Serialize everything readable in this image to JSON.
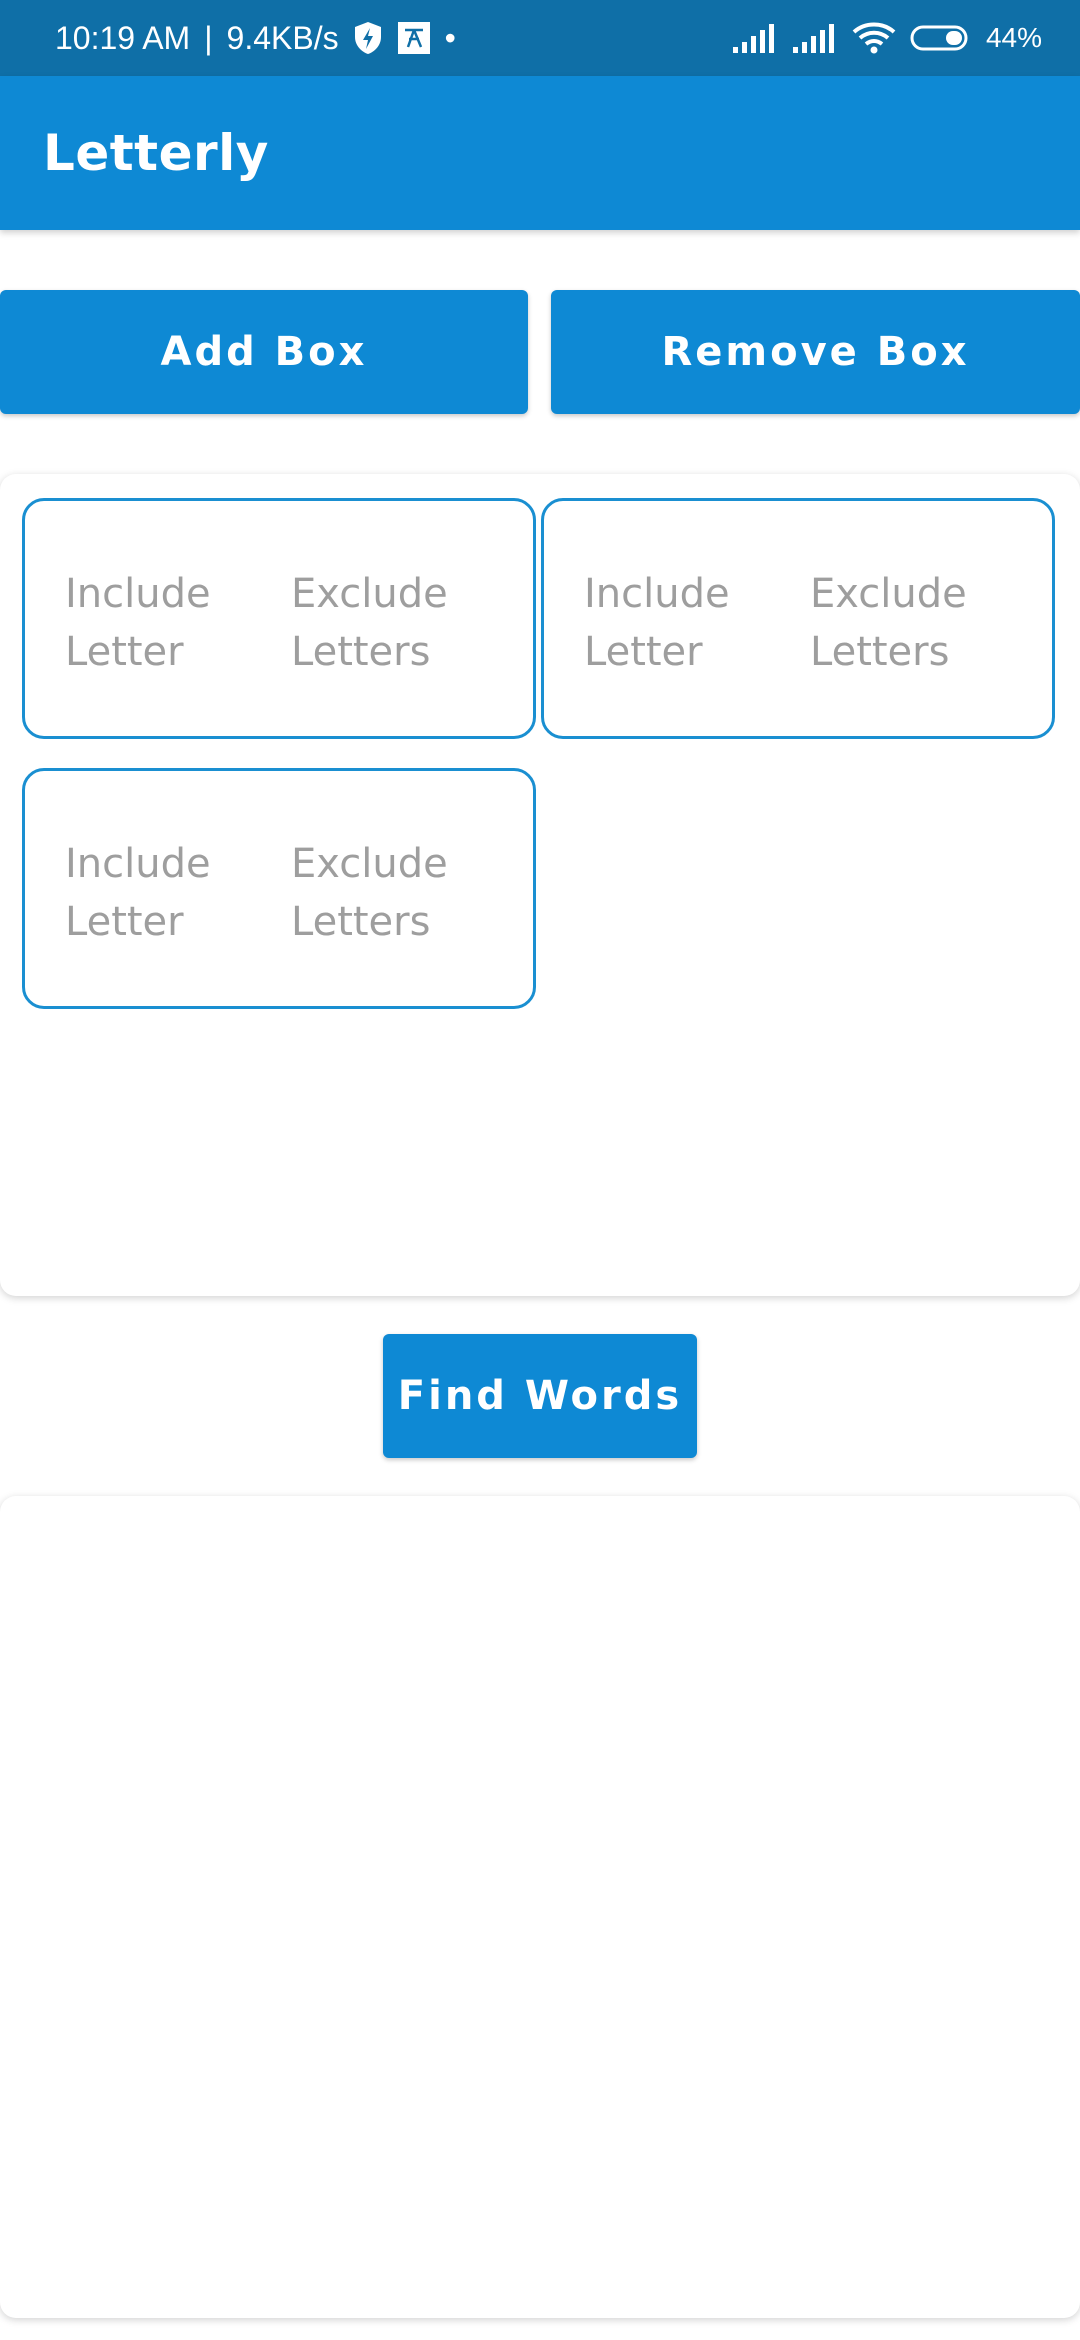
{
  "status_bar": {
    "time": "10:19 AM",
    "separator": "|",
    "speed": "9.4KB/s",
    "dot": "•",
    "battery": "44%",
    "icons": [
      "shield-bolt-icon",
      "app-notification-icon",
      "signal-icon",
      "signal-icon",
      "wifi-icon",
      "battery-icon"
    ]
  },
  "app_bar": {
    "title": "Letterly"
  },
  "actions": {
    "add_label": "Add Box",
    "remove_label": "Remove Box",
    "find_label": "Find Words"
  },
  "boxes": [
    {
      "include_placeholder": "Include\nLetter",
      "exclude_placeholder": "Exclude\nLetters"
    },
    {
      "include_placeholder": "Include\nLetter",
      "exclude_placeholder": "Exclude\nLetters"
    },
    {
      "include_placeholder": "Include\nLetter",
      "exclude_placeholder": "Exclude\nLetters"
    }
  ],
  "colors": {
    "status_bar": "#0f6fa7",
    "primary": "#0e89d4",
    "box_border": "#1a8fd1",
    "placeholder_text": "#9e9e9e",
    "background": "#ffffff"
  }
}
